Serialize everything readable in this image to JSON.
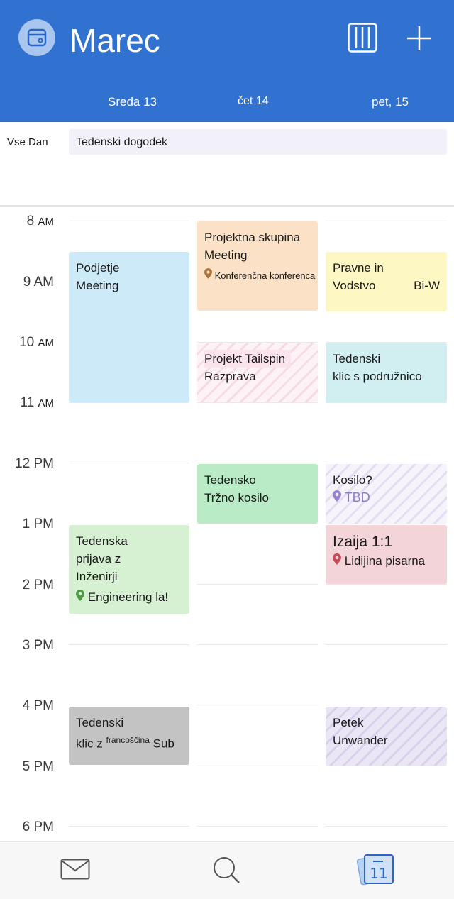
{
  "header": {
    "month": "Marec",
    "days": [
      "Sreda 13",
      "čet 14",
      "pet, 15"
    ],
    "icons": {
      "app": "calendar-app-icon",
      "view": "week-view-icon",
      "add": "plus-icon"
    }
  },
  "allday": {
    "label": "Vse Dan",
    "event": "Tedenski dogodek"
  },
  "times": [
    {
      "num": "8",
      "ampm": "AM"
    },
    {
      "num": "9 AM",
      "ampm": ""
    },
    {
      "num": "10",
      "ampm": "AM"
    },
    {
      "num": "11",
      "ampm": "AM"
    },
    {
      "num": "12 PM",
      "ampm": ""
    },
    {
      "num": "1 PM",
      "ampm": ""
    },
    {
      "num": "2 PM",
      "ampm": ""
    },
    {
      "num": "3 PM",
      "ampm": ""
    },
    {
      "num": "4 PM",
      "ampm": ""
    },
    {
      "num": "5 PM",
      "ampm": ""
    },
    {
      "num": "6 PM",
      "ampm": ""
    }
  ],
  "events": {
    "podjetje": {
      "l1": "Podjetje",
      "l2": "Meeting",
      "color": "#cdeaf9"
    },
    "projektna": {
      "l1": "Projektna skupina",
      "l2": "Meeting",
      "loc": "Konferenčna konferenca",
      "color": "#fbe1c5"
    },
    "pravne": {
      "l1": "Pravne in",
      "l2": "Vodstvo",
      "l3": "Bi-W",
      "color": "#fdf7c3"
    },
    "tailspin": {
      "l1": "Projekt Tailspin",
      "l2": "Razprava"
    },
    "tedenski_klic": {
      "l1": "Tedenski",
      "l2": "klic s podružnico",
      "color": "#d1eef1"
    },
    "trzno": {
      "l1": "Tedensko",
      "l2": "Tržno kosilo",
      "color": "#b9ecc6"
    },
    "kosilo": {
      "l1": "Kosilo?",
      "loc": "TBD"
    },
    "izaija": {
      "l1": "Izaija 1:1",
      "loc": "Lidijina pisarna",
      "color": "#f3d5d9"
    },
    "tedenska": {
      "l1": "Tedenska",
      "l2": "prijava z",
      "l3": "Inženirji",
      "loc": "Engineering la!",
      "color": "#d6f1d2"
    },
    "francoscina": {
      "l1": "Tedenski",
      "l2a": "klic z",
      "l2b": "francoščina",
      "l2c": "Sub",
      "color": "#c3c3c3"
    },
    "petek": {
      "l1": "Petek",
      "l2": "Unwander"
    }
  },
  "tabs": {
    "mail": "mail-icon",
    "search": "search-icon",
    "calendar": "calendar-icon",
    "calendar_day": "11"
  }
}
